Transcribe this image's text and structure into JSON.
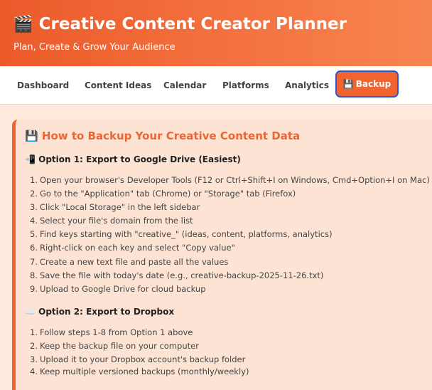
{
  "header": {
    "icon": "🎬",
    "title": "Creative Content Creator Planner",
    "subtitle": "Plan, Create & Grow Your Audience"
  },
  "nav": {
    "items": [
      "Dashboard",
      "Content Ideas",
      "Calendar",
      "Platforms",
      "Analytics"
    ],
    "active": {
      "icon": "💾",
      "label": "Backup"
    }
  },
  "section": {
    "icon": "💾",
    "title": "How to Backup Your Creative Content Data",
    "option1": {
      "icon": "📲",
      "title": "Option 1: Export to Google Drive (Easiest)",
      "steps": [
        "Open your browser's Developer Tools (F12 or Ctrl+Shift+I on Windows, Cmd+Option+I on Mac)",
        "Go to the \"Application\" tab (Chrome) or \"Storage\" tab (Firefox)",
        "Click \"Local Storage\" in the left sidebar",
        "Select your file's domain from the list",
        "Find keys starting with \"creative_\" (ideas, content, platforms, analytics)",
        "Right-click on each key and select \"Copy value\"",
        "Create a new text file and paste all the values",
        "Save the file with today's date (e.g., creative-backup-2025-11-26.txt)",
        "Upload to Google Drive for cloud backup"
      ]
    },
    "option2": {
      "icon": "☁️",
      "title": "Option 2: Export to Dropbox",
      "steps": [
        "Follow steps 1-8 from Option 1 above",
        "Keep the backup file on your computer",
        "Upload it to your Dropbox account's backup folder",
        "Keep multiple versioned backups (monthly/weekly)"
      ]
    }
  },
  "colors": {
    "accent": "#f0642f",
    "active_border": "#2a56d6"
  }
}
